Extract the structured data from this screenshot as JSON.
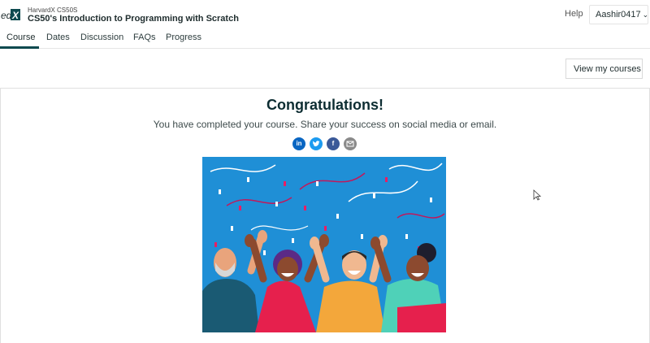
{
  "header": {
    "logo_text": "edX",
    "course_org": "HarvardX CS50S",
    "course_title": "CS50's Introduction to Programming with Scratch",
    "help_label": "Help",
    "username": "Aashir0417"
  },
  "tabs": [
    {
      "label": "Course",
      "active": true
    },
    {
      "label": "Dates"
    },
    {
      "label": "Discussion"
    },
    {
      "label": "FAQs"
    },
    {
      "label": "Progress"
    }
  ],
  "view_courses_label": "View my courses",
  "completion": {
    "title": "Congratulations!",
    "message": "You have completed your course. Share your success on social media or email.",
    "share_icons": [
      "linkedin-icon",
      "twitter-icon",
      "facebook-icon",
      "email-icon"
    ]
  },
  "colors": {
    "accent": "#0d4a4f",
    "illustration_bg": "#1f8fd6"
  }
}
